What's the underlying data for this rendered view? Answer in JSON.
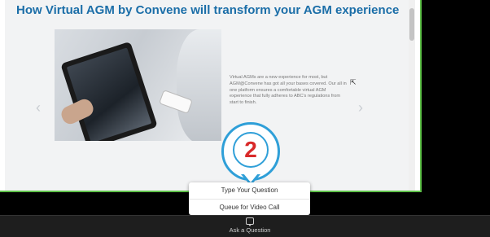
{
  "slide": {
    "title": "How Virtual AGM by Convene will transform your AGM experience",
    "description": "Virtual AGMs are a new experience for most, but AGM@Convene has got all your bases covered. Our all in one platform ensures a comfortable virtual AGM experience that fully adheres to ABC's regulations from start to finish.",
    "prev_arrow": "‹",
    "next_arrow": "›"
  },
  "callout": {
    "step_number": "2"
  },
  "question_menu": {
    "items": [
      "Type Your Question",
      "Queue for Video Call"
    ]
  },
  "toolbar": {
    "ask_question_label": "Ask a Question"
  },
  "colors": {
    "title": "#1b6ea8",
    "share_border": "#5fc24a",
    "badge_ring": "#2f9fd8",
    "badge_number": "#d92a2a",
    "toolbar_bg": "#1e1e1e"
  }
}
